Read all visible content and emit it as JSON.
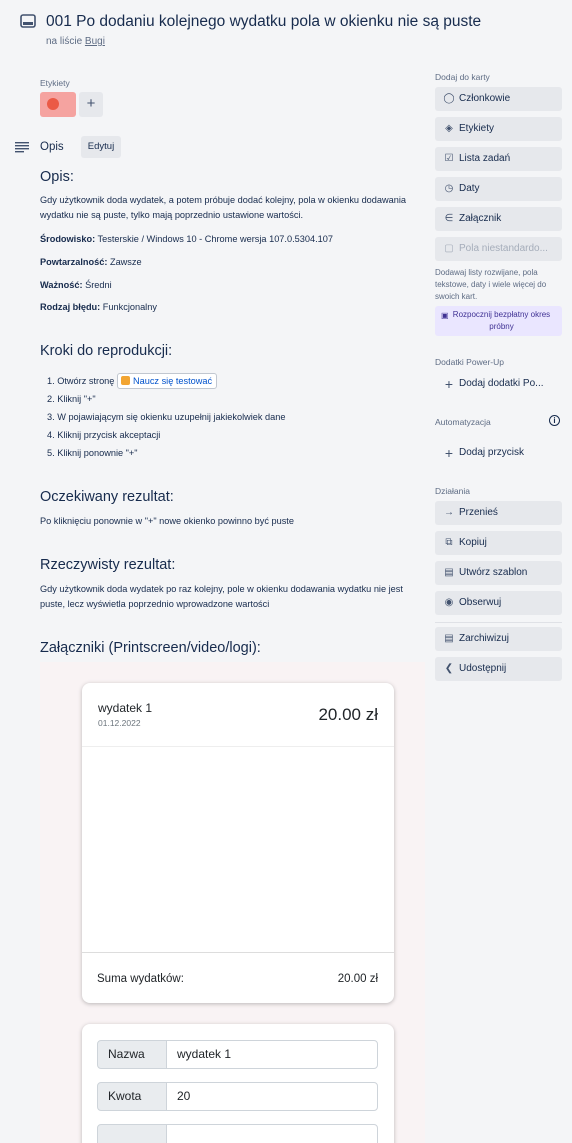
{
  "card": {
    "title": "001 Po dodaniu kolejnego wydatku pola w okienku nie są puste",
    "in_list_prefix": "na liście",
    "list_name": "Bugi"
  },
  "labels": {
    "heading": "Etykiety",
    "color": "#eb5a46"
  },
  "description": {
    "heading": "Opis",
    "edit_label": "Edytuj",
    "opis_title": "Opis:",
    "opis_text": "Gdy użytkownik doda wydatek, a potem próbuje dodać kolejny, pola w okienku dodawania wydatku nie są puste, tylko mają poprzednio ustawione wartości.",
    "env_label": "Środowisko:",
    "env_value": "Testerskie / Windows 10 - Chrome wersja 107.0.5304.107",
    "repeat_label": "Powtarzalność:",
    "repeat_value": "Zawsze",
    "priority_label": "Ważność:",
    "priority_value": "Średni",
    "type_label": "Rodzaj błędu:",
    "type_value": "Funkcjonalny",
    "steps_title": "Kroki do reprodukcji:",
    "step1_prefix": "1. Otwórz stronę",
    "step1_link": "Naucz się testować",
    "step2": "2. Kliknij \"+\"",
    "step3": "3. W pojawiającym się okienku uzupełnij jakiekolwiek dane",
    "step4": "4. Kliknij przycisk akceptacji",
    "step5": "5. Kliknij ponownie \"+\"",
    "expected_title": "Oczekiwany rezultat:",
    "expected_text": "Po kliknięciu ponownie w \"+\" nowe okienko powinno być puste",
    "actual_title": "Rzeczywisty rezultat:",
    "actual_text": "Gdy użytkownik doda wydatek po raz kolejny, pole w okienku dodawania wydatku nie jest puste, lecz wyświetla poprzednio wprowadzone wartości",
    "attachments_title": "Załączniki (Printscreen/video/logi):"
  },
  "screenshot": {
    "expense_name": "wydatek 1",
    "expense_date": "01.12.2022",
    "expense_amount": "20.00 zł",
    "sum_label": "Suma wydatków:",
    "sum_value": "20.00 zł",
    "name_label": "Nazwa",
    "name_value": "wydatek 1",
    "amount_label": "Kwota",
    "amount_value": "20"
  },
  "sidebar": {
    "add_to_card": "Dodaj do karty",
    "members": "Członkowie",
    "labels": "Etykiety",
    "checklist": "Lista zadań",
    "dates": "Daty",
    "attachment": "Załącznik",
    "custom_fields": "Pola niestandardo...",
    "custom_fields_note": "Dodawaj listy rozwijane, pola tekstowe, daty i wiele więcej do swoich kart.",
    "trial": "Rozpocznij bezpłatny okres próbny",
    "powerups_heading": "Dodatki Power-Up",
    "add_powerups": "Dodaj dodatki Po...",
    "automation_heading": "Automatyzacja",
    "add_button": "Dodaj przycisk",
    "actions_heading": "Działania",
    "move": "Przenieś",
    "copy": "Kopiuj",
    "make_template": "Utwórz szablon",
    "watch": "Obserwuj",
    "archive": "Zarchiwizuj",
    "share": "Udostępnij"
  }
}
